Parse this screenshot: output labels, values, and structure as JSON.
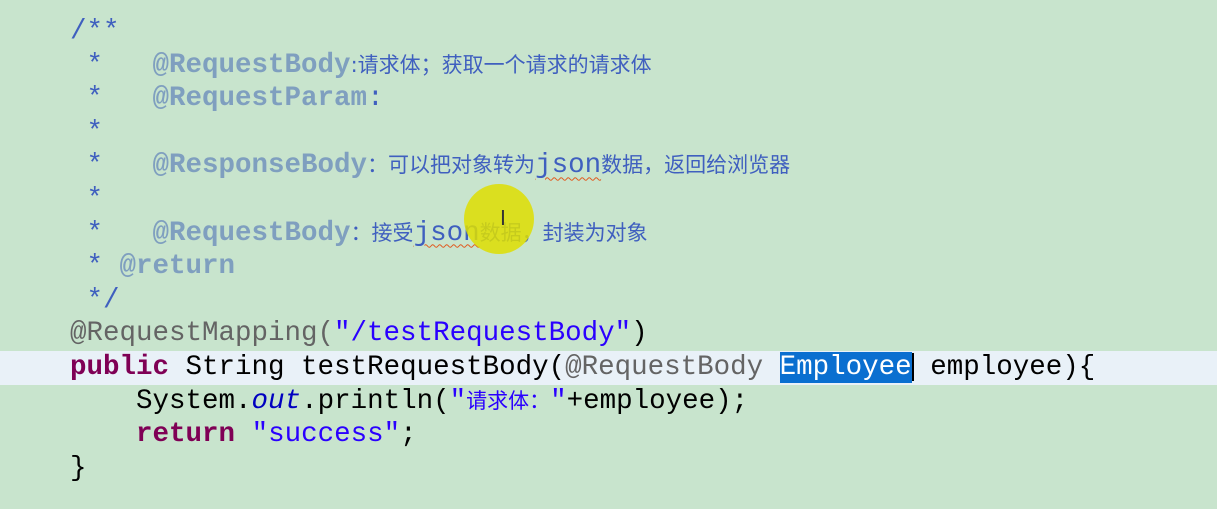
{
  "code": {
    "l1": "/**",
    "l2": {
      "star": " *   ",
      "tag": "@RequestBody",
      "text": ":请求体；获取一个请求的请求体"
    },
    "l3": {
      "star": " *   ",
      "tag": "@RequestParam",
      "text": ":"
    },
    "l4": {
      "star": " *"
    },
    "l5": {
      "star": " *   ",
      "tag": "@ResponseBody",
      "text1": "：可以把对象转为",
      "json": "json",
      "text2": "数据，返回给浏览器"
    },
    "l6": {
      "star": " *"
    },
    "l7": {
      "star": " *   ",
      "tag": "@RequestBody",
      "text1": "：接受",
      "json": "json",
      "text2": "数据，封装为对象"
    },
    "l8": {
      "star": " * ",
      "tag": "@return"
    },
    "l9": " */",
    "l10": {
      "ann": "@RequestMapping(",
      "str": "\"/testRequestBody\"",
      "close": ")"
    },
    "l11": {
      "kw": "public",
      "type": " String testRequestBody(",
      "ann": "@RequestBody ",
      "selected": "Employee",
      "rest": " employee){"
    },
    "l12": {
      "indent": "    ",
      "sys": "System.",
      "out": "out",
      "call": ".println(",
      "q1": "\"",
      "zh": "请求体：",
      "q2": "\"",
      "rest": "+employee);"
    },
    "l13": {
      "indent": "    ",
      "kw": "return",
      "sp": " ",
      "str": "\"success\"",
      "semi": ";"
    },
    "l14": "}"
  },
  "colors": {
    "background": "#c8e4cd",
    "selection": "#0a6fd0",
    "keyword": "#7f0055",
    "string": "#2a00ff",
    "comment": "#3f5fbf"
  }
}
